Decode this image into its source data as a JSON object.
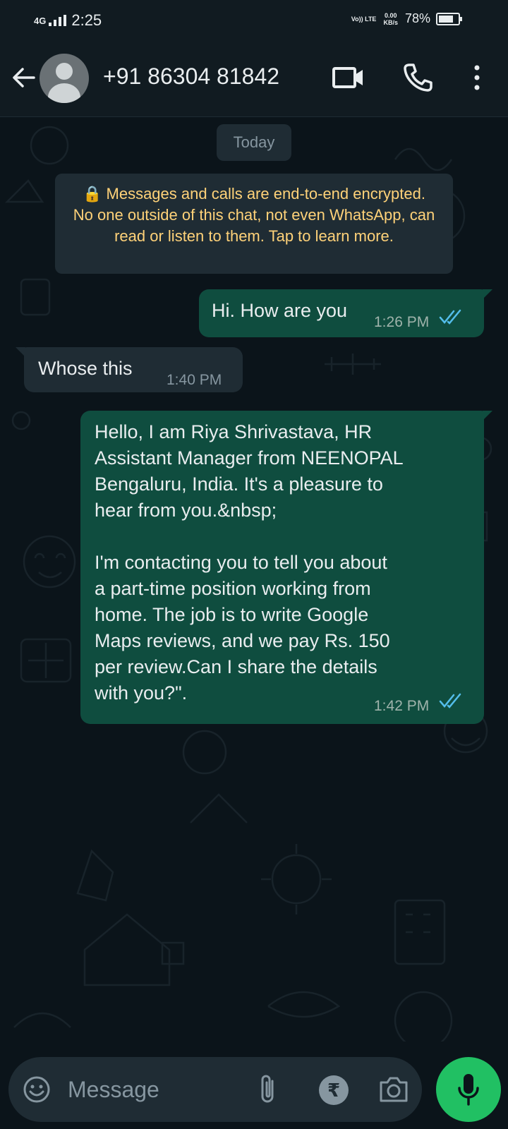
{
  "status_bar": {
    "network": "4G",
    "time": "2:25",
    "volte": "Vo)) LTE",
    "speed": "0.00",
    "speed_unit": "KB/s",
    "battery_percent": "78%",
    "battery_level": 0.78
  },
  "header": {
    "contact_name": "+91 86304 81842",
    "icons": [
      "back-arrow-icon",
      "avatar",
      "video-call-icon",
      "voice-call-icon",
      "more-options-icon"
    ]
  },
  "chat": {
    "date_chip": "Today",
    "encryption_notice": "🔒 Messages and calls are end-to-end encrypted. No one outside of this chat, not even WhatsApp, can read or listen to them. Tap to learn more.",
    "messages": [
      {
        "direction": "outgoing",
        "text": "Hi. How are you",
        "time": "1:26 PM",
        "status": "read"
      },
      {
        "direction": "incoming",
        "text": "Whose this",
        "time": "1:40 PM"
      },
      {
        "direction": "outgoing",
        "text": "Hello, I am Riya Shrivastava, HR\nAssistant Manager from NEENOPAL\nBengaluru, India. It's a pleasure to\nhear from you.&nbsp;\n\nI'm contacting you to tell you about\na part-time position working from\nhome. The job is to write Google\nMaps reviews, and we pay Rs. 150\nper review.Can I share the details\nwith you?\".",
        "time": "1:42 PM",
        "status": "read"
      }
    ]
  },
  "composer": {
    "placeholder": "Message",
    "rupee_symbol": "₹"
  },
  "colors": {
    "background": "#0b141a",
    "bar": "#111b21",
    "outgoing_bubble": "#0f4d3f",
    "incoming_bubble": "#1f2c34",
    "read_ticks": "#53bdeb",
    "encryption_text": "#ffd279",
    "mic_button": "#21c063"
  }
}
